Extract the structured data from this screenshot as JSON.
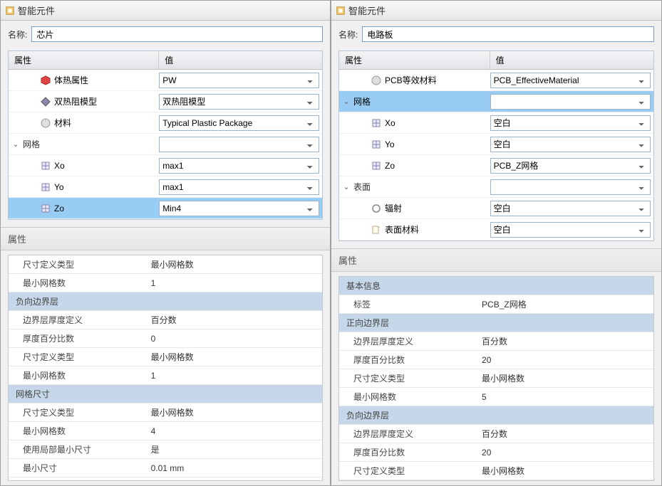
{
  "left": {
    "panel_title": "智能元件",
    "name_label": "名称:",
    "name_value": "芯片",
    "tree_header": {
      "attr": "属性",
      "val": "值"
    },
    "rows": [
      {
        "label": "体热属性",
        "value": "PW",
        "icon": "cube-red"
      },
      {
        "label": "双热阻模型",
        "value": "双热阻模型",
        "icon": "diamond"
      },
      {
        "label": "材料",
        "value": "Typical Plastic Package",
        "icon": "sphere"
      },
      {
        "label": "网格",
        "value": "",
        "group": true
      },
      {
        "label": "Xo",
        "value": "max1",
        "icon": "grid-cube"
      },
      {
        "label": "Yo",
        "value": "max1",
        "icon": "grid-cube"
      },
      {
        "label": "Zo",
        "value": "Min4",
        "icon": "grid-cube",
        "selected": true
      }
    ],
    "prop_title": "属性",
    "props": [
      {
        "label": "尺寸定义类型",
        "value": "最小网格数"
      },
      {
        "label": "最小网格数",
        "value": "1"
      },
      {
        "section": "负向边界层"
      },
      {
        "label": "边界层厚度定义",
        "value": "百分数"
      },
      {
        "label": "厚度百分比数",
        "value": "0"
      },
      {
        "label": "尺寸定义类型",
        "value": "最小网格数"
      },
      {
        "label": "最小网格数",
        "value": "1"
      },
      {
        "section": "网格尺寸"
      },
      {
        "label": "尺寸定义类型",
        "value": "最小网格数"
      },
      {
        "label": "最小网格数",
        "value": "4"
      },
      {
        "label": "使用局部最小尺寸",
        "value": "是"
      },
      {
        "label": "最小尺寸",
        "value": "0.01 mm"
      }
    ]
  },
  "right": {
    "panel_title": "智能元件",
    "name_label": "名称:",
    "name_value": "电路板",
    "tree_header": {
      "attr": "属性",
      "val": "值"
    },
    "rows": [
      {
        "label": "PCB等效材料",
        "value": "PCB_EffectiveMaterial",
        "icon": "sphere"
      },
      {
        "label": "网格",
        "value": "",
        "group": true,
        "selected": true
      },
      {
        "label": "Xo",
        "value": "空白",
        "icon": "grid-cube"
      },
      {
        "label": "Yo",
        "value": "空白",
        "icon": "grid-cube"
      },
      {
        "label": "Zo",
        "value": "PCB_Z网格",
        "icon": "grid-cube"
      },
      {
        "label": "表面",
        "value": "",
        "group": true
      },
      {
        "label": "辐射",
        "value": "空白",
        "icon": "circle"
      },
      {
        "label": "表面材料",
        "value": "空白",
        "icon": "sheet"
      }
    ],
    "prop_title": "属性",
    "props": [
      {
        "section": "基本信息"
      },
      {
        "label": "标签",
        "value": "PCB_Z网格"
      },
      {
        "section": "正向边界层"
      },
      {
        "label": "边界层厚度定义",
        "value": "百分数"
      },
      {
        "label": "厚度百分比数",
        "value": "20"
      },
      {
        "label": "尺寸定义类型",
        "value": "最小网格数"
      },
      {
        "label": "最小网格数",
        "value": "5"
      },
      {
        "section": "负向边界层"
      },
      {
        "label": "边界层厚度定义",
        "value": "百分数"
      },
      {
        "label": "厚度百分比数",
        "value": "20"
      },
      {
        "label": "尺寸定义类型",
        "value": "最小网格数"
      }
    ]
  },
  "expander_collapsed": "⌄",
  "expander_expanded": "⌄"
}
